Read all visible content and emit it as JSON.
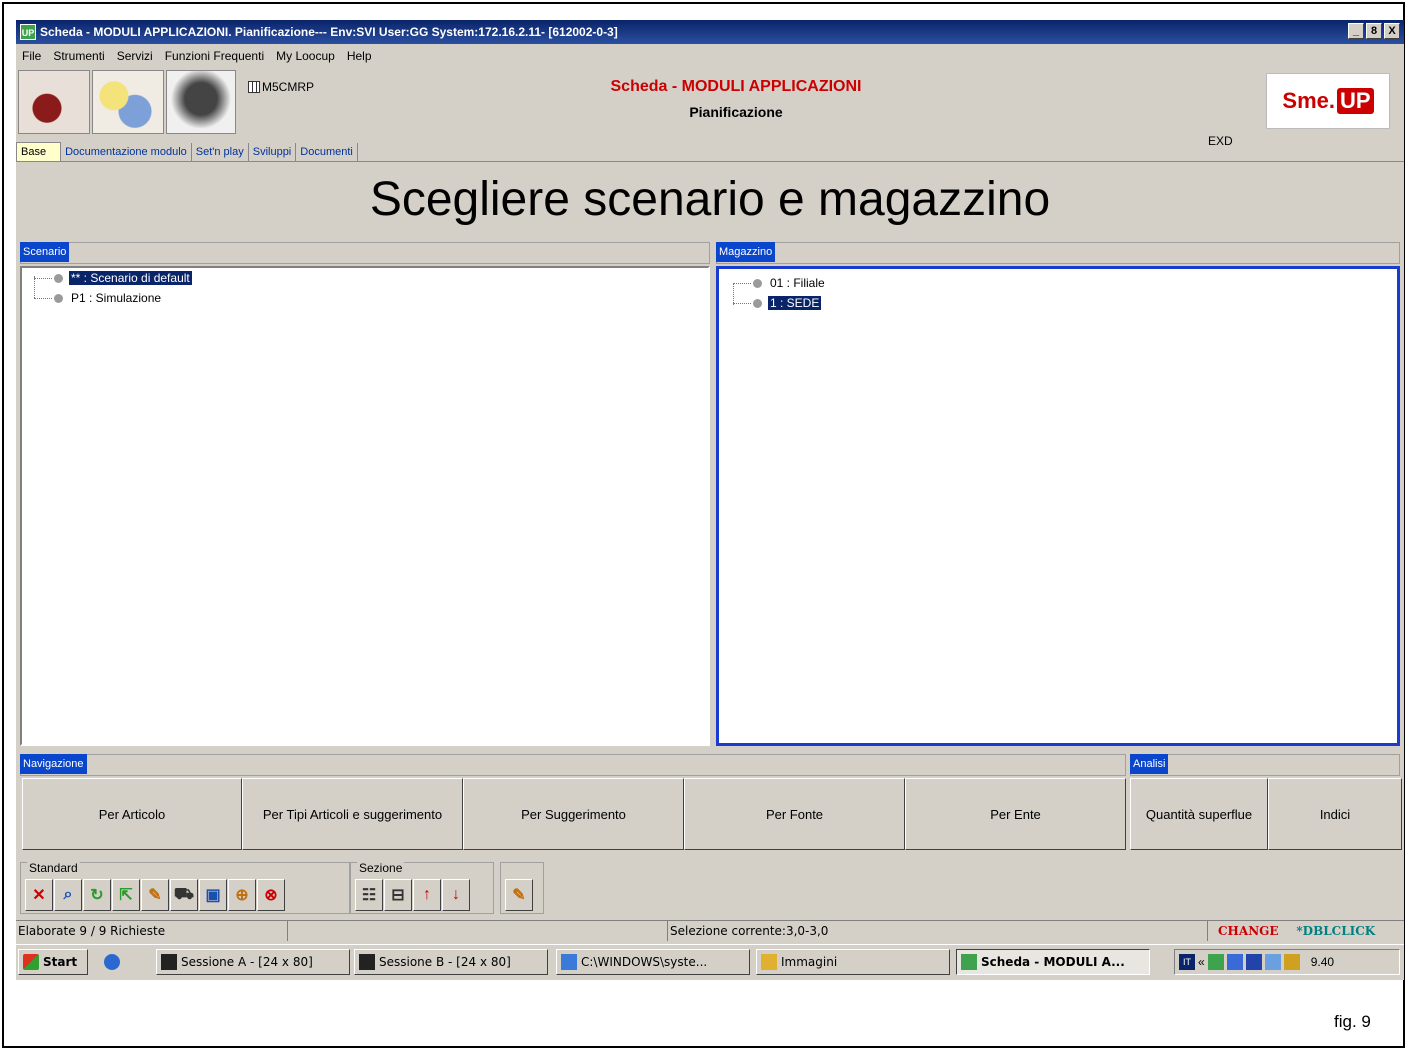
{
  "window": {
    "title": "Scheda - MODULI APPLICAZIONI. Pianificazione--- Env:SVI User:GG System:172.16.2.11- [612002-0-3]",
    "app_icon": "UP",
    "buttons": [
      "_",
      "8",
      "X"
    ]
  },
  "menu": [
    "File",
    "Strumenti",
    "Servizi",
    "Funzioni Frequenti",
    "My Loocup",
    "Help"
  ],
  "header": {
    "module_code": "M5CMRP",
    "title": "Scheda - MODULI APPLICAZIONI",
    "subtitle": "Pianificazione",
    "exd": "EXD",
    "logo_text": "Sme.",
    "logo_up": "UP"
  },
  "tabs": [
    "Base",
    "Documentazione modulo",
    "Set'n play",
    "Sviluppi",
    "Documenti"
  ],
  "banner": "Scegliere scenario e magazzino",
  "scenario": {
    "label": "Scenario",
    "items": [
      {
        "text": "** : Scenario di default",
        "selected": true
      },
      {
        "text": "P1 : Simulazione",
        "selected": false
      }
    ]
  },
  "magazzino": {
    "label": "Magazzino",
    "items": [
      {
        "text": "01 : Filiale",
        "selected": false
      },
      {
        "text": "1 : SEDE",
        "selected": true
      }
    ]
  },
  "navigazione": {
    "label": "Navigazione",
    "buttons": [
      "Per Articolo",
      "Per Tipi Articoli e suggerimento",
      "Per Suggerimento",
      "Per Fonte",
      "Per Ente"
    ]
  },
  "analisi": {
    "label": "Analisi",
    "buttons": [
      "Quantità superflue",
      "Indici"
    ]
  },
  "toolbar": {
    "standard_label": "Standard",
    "sezione_label": "Sezione",
    "standard_icons": [
      "close-icon",
      "search-icon",
      "refresh-icon",
      "export-icon",
      "edit-icon",
      "cart-icon",
      "image-icon",
      "zoom-icon",
      "stop-icon"
    ],
    "sezione_icons": [
      "tree-icon",
      "layout-icon",
      "arrow-up-icon",
      "arrow-down-icon"
    ],
    "extra_icons": [
      "edit-icon"
    ]
  },
  "status": {
    "elaborate": "Elaborate 9 / 9 Richieste",
    "selection": "Selezione corrente:3,0-3,0",
    "change": "CHANGE",
    "dblclick": "*DBLCLICK"
  },
  "taskbar": {
    "start": "Start",
    "tasks": [
      "Sessione A - [24 x 80]",
      "Sessione B - [24 x 80]",
      "C:\\WINDOWS\\syste...",
      "Immagini",
      "Scheda - MODULI A..."
    ],
    "clock": "9.40",
    "tray_lang": "IT"
  },
  "figure_label": "fig. 9",
  "colors": {
    "titlebar": "#0a246a",
    "accent_red": "#cc0000",
    "selection": "#0a246a",
    "panel_label": "#0a46cc"
  }
}
